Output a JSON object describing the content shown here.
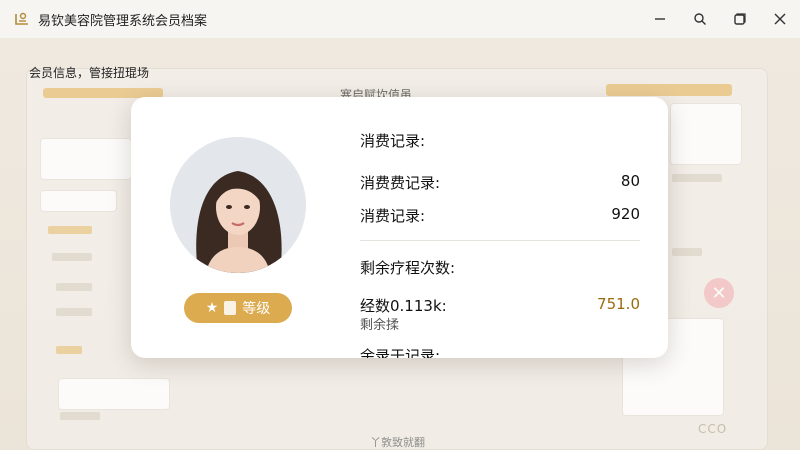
{
  "window": {
    "title": "易钦美容院管理系统会员档案",
    "icon": "app-logo-icon",
    "controls": [
      "minimize-icon",
      "search-icon",
      "restore-icon",
      "close-icon"
    ]
  },
  "background": {
    "breadcrumb": "会员信息，管接扭琨场",
    "header": "塞启赋坎值黾",
    "bottom_text": "丫敦致就翻",
    "corner_text": "CCO"
  },
  "modal": {
    "avatar": "member-avatar",
    "level_label": "等级",
    "section_consumption": "消费记录:",
    "rows": [
      {
        "label": "消费费记录:",
        "value": "80"
      },
      {
        "label": "消费记录:",
        "value": "920"
      }
    ],
    "section_remaining": "剩余疗程次数:",
    "remaining_row": {
      "label": "经数0.113k:",
      "value": "751.0"
    },
    "remaining_sub": "剩余揉",
    "cut_text": "余录于记录:",
    "colors": {
      "accent": "#dcaa4f",
      "value_gold": "#9a6b10"
    }
  }
}
